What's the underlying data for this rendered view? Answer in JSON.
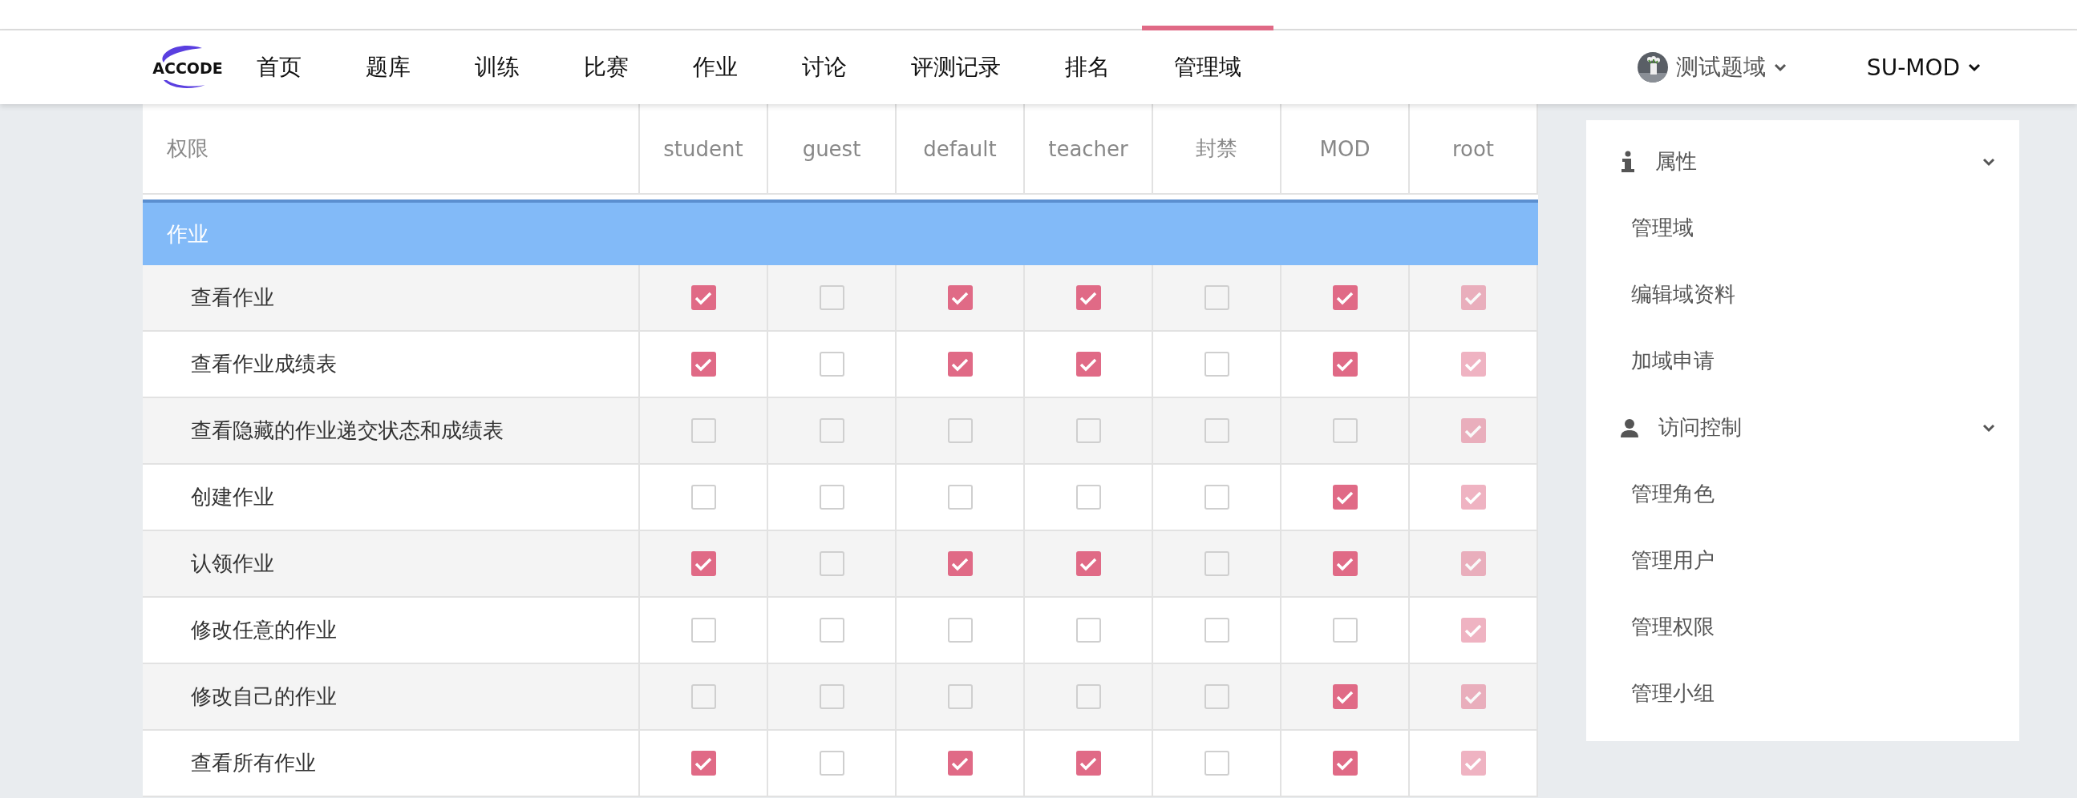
{
  "logo": {
    "text": "ACCODE"
  },
  "nav": [
    {
      "label": "首页",
      "selected": false
    },
    {
      "label": "题库",
      "selected": false
    },
    {
      "label": "训练",
      "selected": false
    },
    {
      "label": "比赛",
      "selected": false
    },
    {
      "label": "作业",
      "selected": false
    },
    {
      "label": "讨论",
      "selected": false
    },
    {
      "label": "评测记录",
      "selected": false
    },
    {
      "label": "排名",
      "selected": false
    },
    {
      "label": "管理域",
      "selected": true
    }
  ],
  "domain_menu": {
    "label": "测试题域"
  },
  "user_menu": {
    "label": "SU-MOD"
  },
  "table": {
    "columns": [
      "权限",
      "student",
      "guest",
      "default",
      "teacher",
      "封禁",
      "MOD",
      "root"
    ],
    "section": "作业",
    "rows": [
      {
        "label": "查看作业",
        "cells": [
          {
            "checked": true,
            "disabled": false
          },
          {
            "checked": false,
            "disabled": false
          },
          {
            "checked": true,
            "disabled": false
          },
          {
            "checked": true,
            "disabled": false
          },
          {
            "checked": false,
            "disabled": false
          },
          {
            "checked": true,
            "disabled": false
          },
          {
            "checked": true,
            "disabled": true
          }
        ]
      },
      {
        "label": "查看作业成绩表",
        "cells": [
          {
            "checked": true,
            "disabled": false
          },
          {
            "checked": false,
            "disabled": false
          },
          {
            "checked": true,
            "disabled": false
          },
          {
            "checked": true,
            "disabled": false
          },
          {
            "checked": false,
            "disabled": false
          },
          {
            "checked": true,
            "disabled": false
          },
          {
            "checked": true,
            "disabled": true
          }
        ]
      },
      {
        "label": "查看隐藏的作业递交状态和成绩表",
        "cells": [
          {
            "checked": false,
            "disabled": false
          },
          {
            "checked": false,
            "disabled": false
          },
          {
            "checked": false,
            "disabled": false
          },
          {
            "checked": false,
            "disabled": false
          },
          {
            "checked": false,
            "disabled": false
          },
          {
            "checked": false,
            "disabled": false
          },
          {
            "checked": true,
            "disabled": true
          }
        ]
      },
      {
        "label": "创建作业",
        "cells": [
          {
            "checked": false,
            "disabled": false
          },
          {
            "checked": false,
            "disabled": false
          },
          {
            "checked": false,
            "disabled": false
          },
          {
            "checked": false,
            "disabled": false
          },
          {
            "checked": false,
            "disabled": false
          },
          {
            "checked": true,
            "disabled": false
          },
          {
            "checked": true,
            "disabled": true
          }
        ]
      },
      {
        "label": "认领作业",
        "cells": [
          {
            "checked": true,
            "disabled": false
          },
          {
            "checked": false,
            "disabled": false
          },
          {
            "checked": true,
            "disabled": false
          },
          {
            "checked": true,
            "disabled": false
          },
          {
            "checked": false,
            "disabled": false
          },
          {
            "checked": true,
            "disabled": false
          },
          {
            "checked": true,
            "disabled": true
          }
        ]
      },
      {
        "label": "修改任意的作业",
        "cells": [
          {
            "checked": false,
            "disabled": false
          },
          {
            "checked": false,
            "disabled": false
          },
          {
            "checked": false,
            "disabled": false
          },
          {
            "checked": false,
            "disabled": false
          },
          {
            "checked": false,
            "disabled": false
          },
          {
            "checked": false,
            "disabled": false
          },
          {
            "checked": true,
            "disabled": true
          }
        ]
      },
      {
        "label": "修改自己的作业",
        "cells": [
          {
            "checked": false,
            "disabled": false
          },
          {
            "checked": false,
            "disabled": false
          },
          {
            "checked": false,
            "disabled": false
          },
          {
            "checked": false,
            "disabled": false
          },
          {
            "checked": false,
            "disabled": false
          },
          {
            "checked": true,
            "disabled": false
          },
          {
            "checked": true,
            "disabled": true
          }
        ]
      },
      {
        "label": "查看所有作业",
        "cells": [
          {
            "checked": true,
            "disabled": false
          },
          {
            "checked": false,
            "disabled": false
          },
          {
            "checked": true,
            "disabled": false
          },
          {
            "checked": true,
            "disabled": false
          },
          {
            "checked": false,
            "disabled": false
          },
          {
            "checked": true,
            "disabled": false
          },
          {
            "checked": true,
            "disabled": true
          }
        ]
      }
    ]
  },
  "sidebar": [
    {
      "title": "属性",
      "kind": "info",
      "expanded": true,
      "items": [
        "管理域",
        "编辑域资料",
        "加域申请"
      ]
    },
    {
      "title": "访问控制",
      "kind": "user",
      "expanded": true,
      "items": [
        "管理角色",
        "管理用户",
        "管理权限",
        "管理小组"
      ]
    }
  ]
}
